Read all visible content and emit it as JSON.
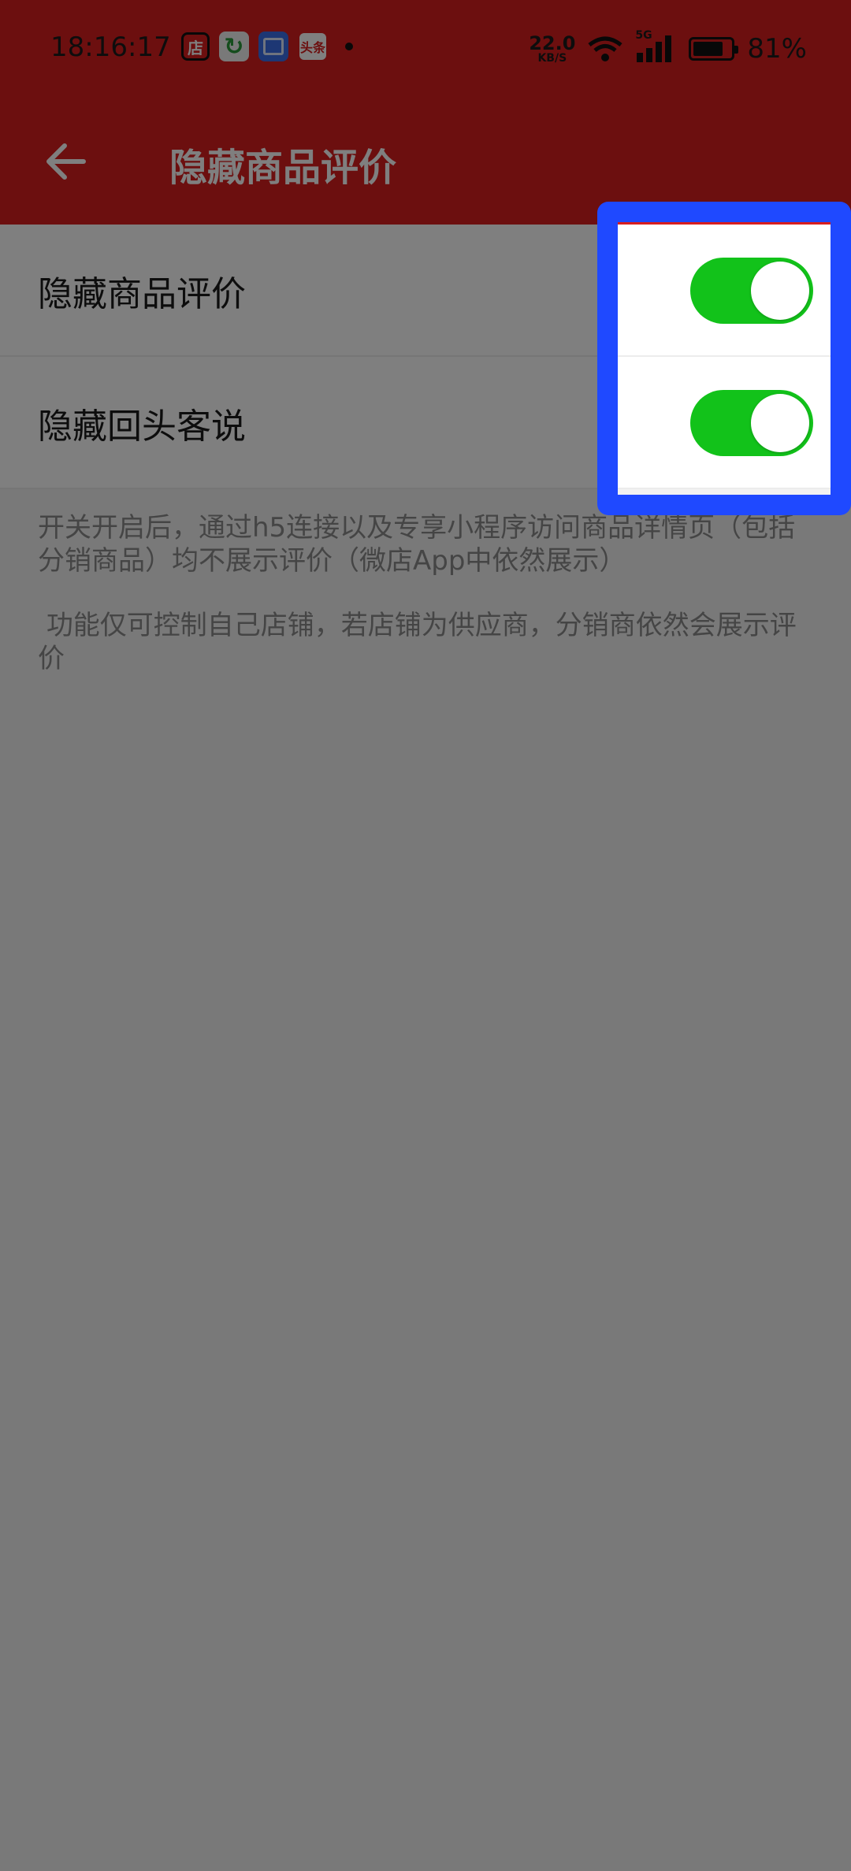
{
  "status_bar": {
    "time": "18:16:17",
    "net_speed": {
      "value": "22.0",
      "unit": "KB/S"
    },
    "signal_label": "5G",
    "battery_percent_text": "81%",
    "battery_level": 0.81,
    "notification_icons": [
      "dian-app-icon",
      "refresh-app-icon",
      "blue-app-icon",
      "toutiao-app-icon"
    ],
    "toutiao_text": "头条",
    "dian_text": "店"
  },
  "toolbar": {
    "title": "隐藏商品评价",
    "back_icon": "arrow-left-icon",
    "background_color": "#d81e1e"
  },
  "settings": [
    {
      "label": "隐藏商品评价",
      "enabled": true
    },
    {
      "label": "隐藏回头客说",
      "enabled": true
    }
  ],
  "notes": [
    "开关开启后，通过h5连接以及专享小程序访问商品详情页（包括分销商品）均不展示评价（微店App中依然展示）",
    " 功能仅可控制自己店铺，若店铺为供应商，分销商依然会展示评价"
  ],
  "colors": {
    "switch_on": "#12c21a",
    "highlight_border": "#1f49ff",
    "dim_overlay": "rgba(0,0,0,0.5)"
  }
}
